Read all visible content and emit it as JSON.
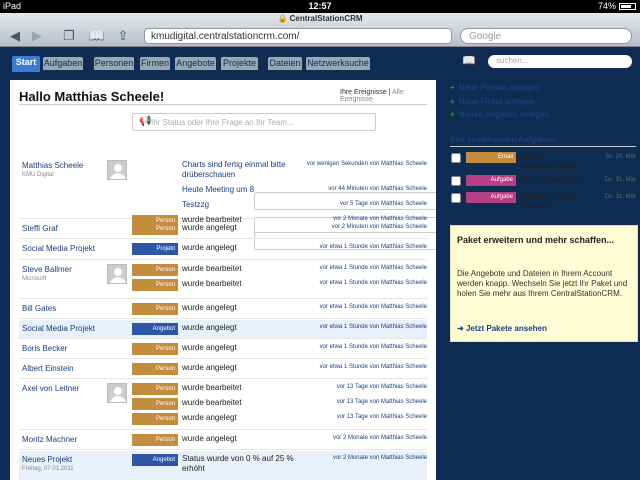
{
  "statusbar": {
    "device": "iPad",
    "time": "12:57",
    "battery": "74%",
    "battery_level": 0.74
  },
  "browser": {
    "title": "CentralStationCRM",
    "url": "kmudigital.centralstationcrm.com/",
    "search_placeholder": "Google"
  },
  "nav": {
    "tabs": [
      "Start",
      "Aufgaben",
      "Personen",
      "Firmen",
      "Angebote",
      "Projekte",
      "Dateien",
      "Netzwerksuche"
    ],
    "active_tab": "Start",
    "search_placeholder": "suchen..."
  },
  "main": {
    "greeting": "Hallo Matthias Scheele!",
    "filter_mine": "Ihre Ereignisse",
    "filter_sep": "|",
    "filter_all": "Alle Ereignisse",
    "status_placeholder": "Ihr Status oder Ihre Frage an Ihr Team...",
    "rows": [
      {
        "name": "Matthias Scheele",
        "sub": "KMU Digital",
        "avatar": true,
        "events": [
          {
            "badge": "Status",
            "text": "Charts sind fertig einmal bitte drüberschauen",
            "time": "vor wenigen Sekunden von Matthias Scheele"
          },
          {
            "badge": "Status",
            "text": "Heute Meeting um 8",
            "time": "vor 44 Minuten von Matthias Scheele"
          },
          {
            "badge": "Status",
            "text": "Testzzg",
            "time": "vor 5 Tage von Matthias Scheele"
          },
          {
            "badge": "Person",
            "text": "wurde bearbeitet",
            "time": "vor 2 Monate von Matthias Scheele"
          }
        ]
      },
      {
        "name": "Steffi Graf",
        "events": [
          {
            "badge": "Person",
            "text": "wurde angelegt",
            "time": "vor 2 Minuten von Matthias Scheele"
          }
        ]
      },
      {
        "name": "Social Media Projekt",
        "events": [
          {
            "badge": "Projekt",
            "text": "wurde angelegt",
            "time": "vor etwa 1 Stunde von Matthias Scheele"
          }
        ]
      },
      {
        "name": "Steve Ballmer",
        "sub": "Microsoft",
        "avatar": true,
        "events": [
          {
            "badge": "Person",
            "text": "wurde bearbeitet",
            "time": "vor etwa 1 Stunde von Matthias Scheele"
          },
          {
            "badge": "Person",
            "text": "wurde bearbeitet",
            "time": "vor etwa 1 Stunde von Matthias Scheele"
          }
        ]
      },
      {
        "name": "Bill Gates",
        "events": [
          {
            "badge": "Person",
            "text": "wurde angelegt",
            "time": "vor etwa 1 Stunde von Matthias Scheele"
          }
        ]
      },
      {
        "name": "Social Media Projekt",
        "highlight": true,
        "events": [
          {
            "badge": "Angebot",
            "text": "wurde angelegt",
            "time": "vor etwa 1 Stunde von Matthias Scheele"
          }
        ]
      },
      {
        "name": "Boris Becker",
        "events": [
          {
            "badge": "Person",
            "text": "wurde angelegt",
            "time": "vor etwa 1 Stunde von Matthias Scheele"
          }
        ]
      },
      {
        "name": "Albert Einstein",
        "events": [
          {
            "badge": "Person",
            "text": "wurde angelegt",
            "time": "vor etwa 1 Stunde von Matthias Scheele"
          }
        ]
      },
      {
        "name": "Axel von Leitner",
        "avatar": true,
        "events": [
          {
            "badge": "Person",
            "text": "wurde bearbeitet",
            "time": "vor 13 Tage von Matthias Scheele"
          },
          {
            "badge": "Person",
            "text": "wurde bearbeitet",
            "time": "vor 13 Tage von Matthias Scheele"
          },
          {
            "badge": "Person",
            "text": "wurde angelegt",
            "time": "vor 13 Tage von Matthias Scheele"
          }
        ]
      },
      {
        "name": "Moritz Machner",
        "events": [
          {
            "badge": "Person",
            "text": "wurde angelegt",
            "time": "vor 2 Monate von Matthias Scheele"
          }
        ]
      },
      {
        "name": "Neues Projekt",
        "sub": "Freitag, 07.01.2011",
        "highlight": true,
        "events": [
          {
            "badge": "Angebot",
            "text": "Status wurde von 0 % auf 25 % erhöht",
            "time": "vor 2 Monate von Matthias Scheele"
          }
        ]
      }
    ]
  },
  "sidebar": {
    "add_person": "Neue Person anlegen",
    "add_company": "Neue Firma anlegen",
    "add_offer": "Neues Angebot anlegen",
    "tasks_heading": "Ihre anstehenden Aufgaben",
    "tasks": [
      {
        "type": "Email",
        "text": "Becker benachrichtigen",
        "date": "So. 20. Mär"
      },
      {
        "type": "Aufgabe",
        "text": "Konzept erstellen",
        "date": "Do. 31. Mär"
      },
      {
        "type": "Aufgabe",
        "text": "Ballmer Konzept schicken",
        "date": "Do. 31. Mär"
      }
    ],
    "promo": {
      "heading": "Paket erweitern und mehr schaffen...",
      "text": "Die Angebote und Dateien in Ihrem Account werden knapp. Wechseln Sie jetzt Ihr Paket und holen Sie mehr aus Ihrem CentralStationCRM.",
      "link": "Jetzt Pakete ansehen"
    }
  },
  "colors": {
    "nav_bg": "#0f2d52",
    "active_tab": "#3b7bd5",
    "person": "#c48d3e",
    "projekt": "#2d55a8",
    "aufgabe": "#b73f86",
    "status": "#3a8a3a"
  }
}
